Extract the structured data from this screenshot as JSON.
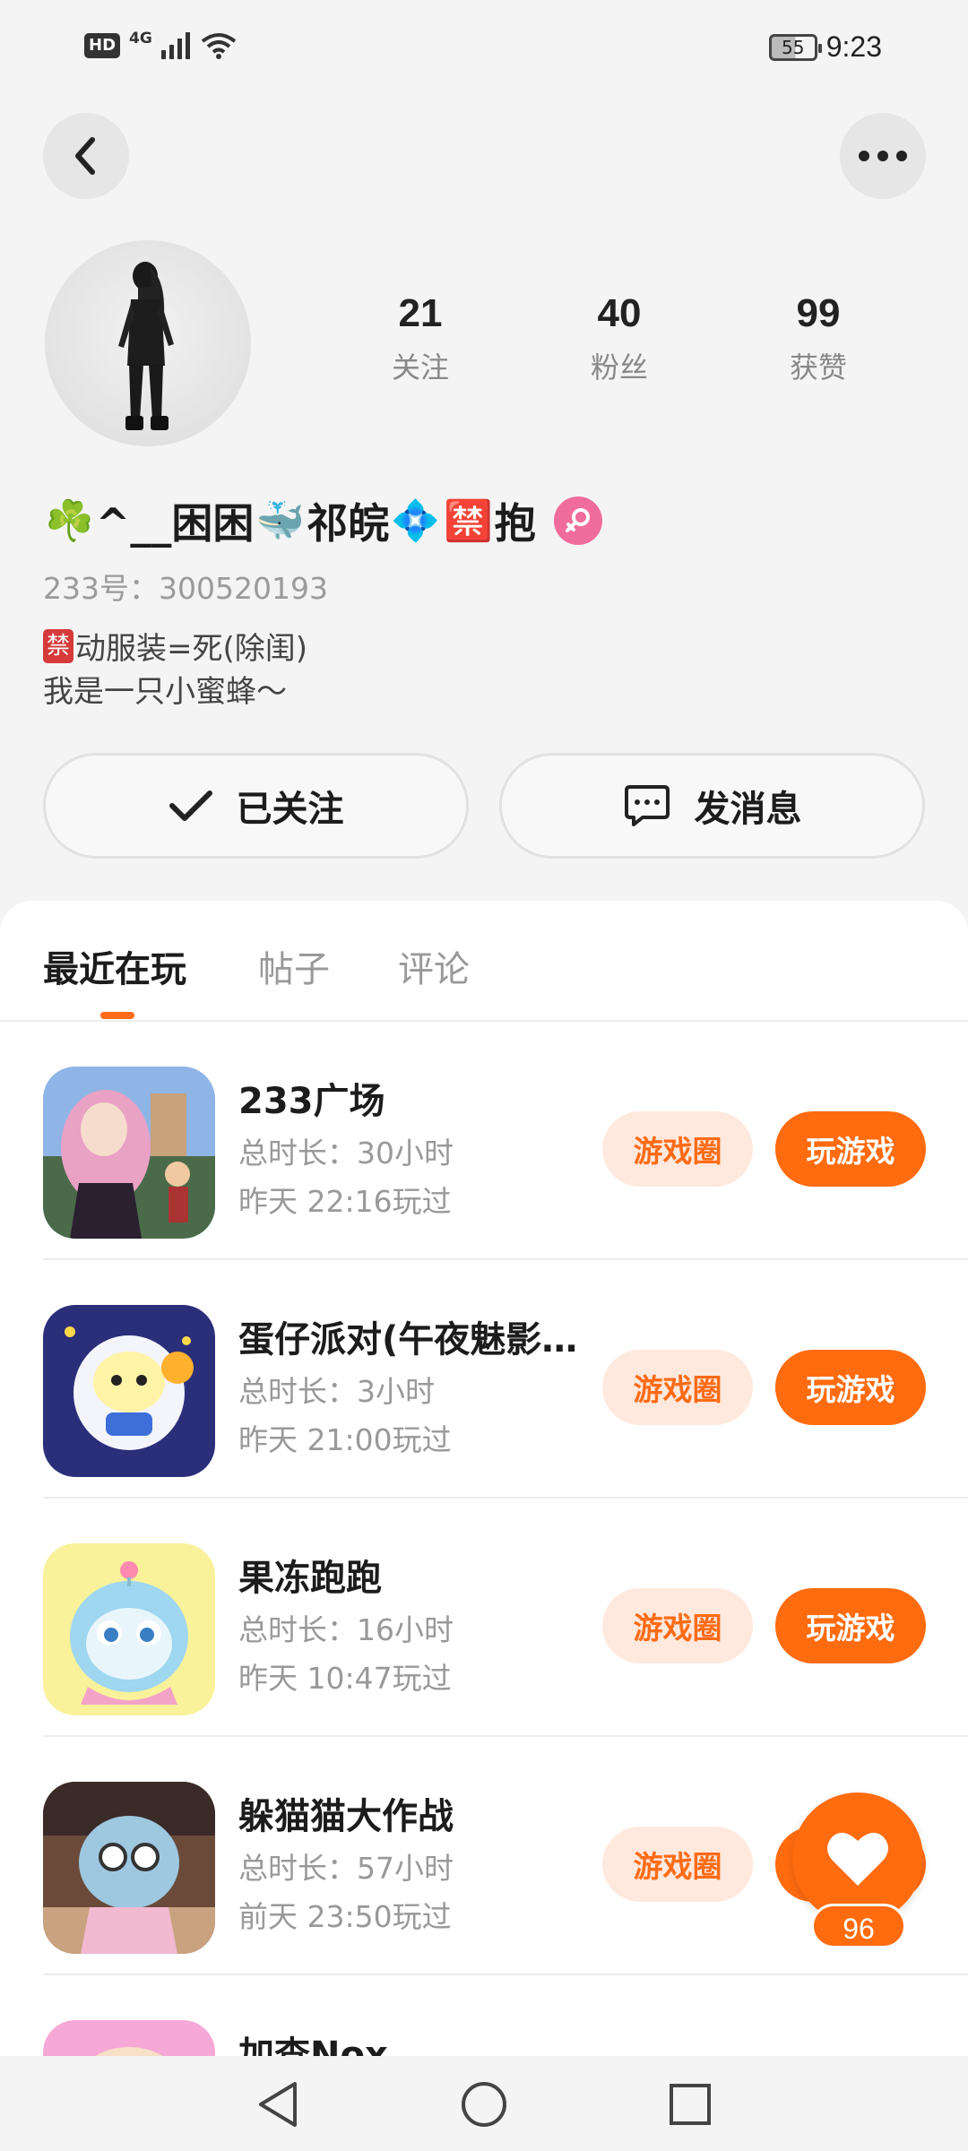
{
  "status_bar": {
    "hd": "HD",
    "network": "4G",
    "battery": "55",
    "time": "9:23"
  },
  "profile": {
    "stats": [
      {
        "value": "21",
        "label": "关注"
      },
      {
        "value": "40",
        "label": "粉丝"
      },
      {
        "value": "99",
        "label": "获赞"
      }
    ],
    "nickname_parts": [
      "☘️",
      "^__困困",
      "🐳",
      "祁皖",
      "💠",
      "🈲",
      "抱"
    ],
    "uid": "233号：300520193",
    "bio_ban": "禁",
    "bio_line1": "动服装=死(除闺)",
    "bio_line2": "我是一只小蜜蜂～",
    "follow_label": "已关注",
    "message_label": "发消息"
  },
  "tabs": [
    {
      "label": "最近在玩"
    },
    {
      "label": "帖子"
    },
    {
      "label": "评论"
    }
  ],
  "games": [
    {
      "title": "233广场",
      "duration": "总时长：30小时",
      "last_played": "昨天 22:16玩过",
      "circle": "游戏圈",
      "play": "玩游戏"
    },
    {
      "title": "蛋仔派对(午夜魅影…",
      "duration": "总时长：3小时",
      "last_played": "昨天 21:00玩过",
      "circle": "游戏圈",
      "play": "玩游戏"
    },
    {
      "title": "果冻跑跑",
      "duration": "总时长：16小时",
      "last_played": "昨天 10:47玩过",
      "circle": "游戏圈",
      "play": "玩游戏"
    },
    {
      "title": "躲猫猫大作战",
      "duration": "总时长：57小时",
      "last_played": "前天 23:50玩过",
      "circle": "游戏圈",
      "play": "玩游戏"
    },
    {
      "title": "加查Nox",
      "duration": "",
      "last_played": "",
      "circle": "",
      "play": ""
    }
  ],
  "like_fab": {
    "count": "96"
  },
  "colors": {
    "accent": "#ff6b0f",
    "accent_light": "#ffe9de",
    "gender": "#f06c9a"
  },
  "icons": [
    "back-icon",
    "more-icon",
    "check-icon",
    "chat-icon",
    "female-icon",
    "heart-icon",
    "nav-back-icon",
    "nav-home-icon",
    "nav-recents-icon"
  ]
}
